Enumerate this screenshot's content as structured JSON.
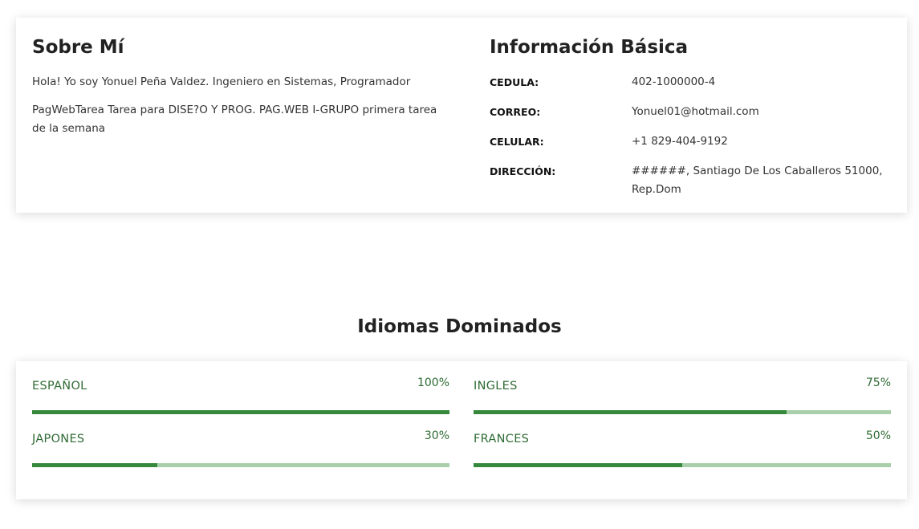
{
  "about": {
    "title": "Sobre Mí",
    "paragraph1": "Hola! Yo soy Yonuel Peña Valdez. Ingeniero en Sistemas, Programador",
    "paragraph2": "PagWebTarea Tarea para DISE?O Y PROG. PAG.WEB I-GRUPO primera tarea de la semana"
  },
  "info": {
    "title": "Información Básica",
    "rows": [
      {
        "label": "CEDULA:",
        "value": "402-1000000-4"
      },
      {
        "label": "CORREO:",
        "value": "Yonuel01@hotmail.com"
      },
      {
        "label": "CELULAR:",
        "value": "+1 829-404-9192"
      },
      {
        "label": "DIRECCIÓN:",
        "value": "######, Santiago De Los Caballeros 51000, Rep.Dom"
      }
    ]
  },
  "languages": {
    "title": "Idiomas Dominados",
    "items": [
      {
        "name": "ESPAÑOL",
        "percent_label": "100%",
        "percent": 100
      },
      {
        "name": "INGLES",
        "percent_label": "75%",
        "percent": 75
      },
      {
        "name": "JAPONES",
        "percent_label": "30%",
        "percent": 30
      },
      {
        "name": "FRANCES",
        "percent_label": "50%",
        "percent": 50
      }
    ]
  },
  "colors": {
    "accent": "#36883c",
    "track": "#a9cfaa",
    "label": "#2f6b34"
  }
}
